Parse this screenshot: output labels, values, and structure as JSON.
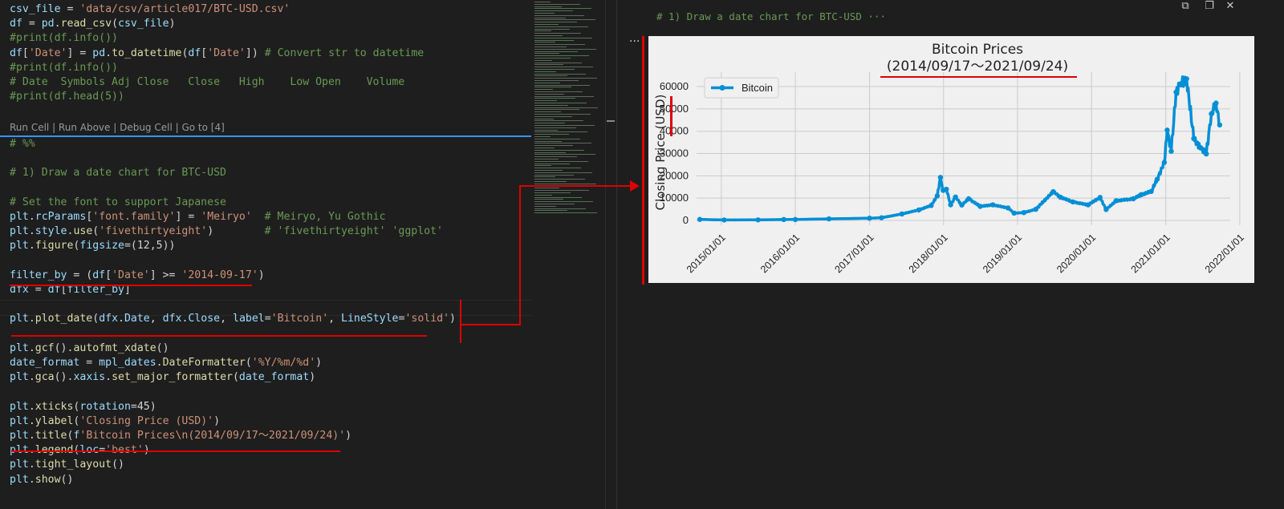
{
  "editor": {
    "lines": [
      {
        "parts": [
          {
            "c": "var",
            "t": "csv_file"
          },
          {
            "c": "plain",
            "t": " = "
          },
          {
            "c": "str",
            "t": "'data/csv/article017/BTC-USD.csv'"
          }
        ]
      },
      {
        "parts": [
          {
            "c": "var",
            "t": "df"
          },
          {
            "c": "plain",
            "t": " = "
          },
          {
            "c": "var",
            "t": "pd"
          },
          {
            "c": "plain",
            "t": "."
          },
          {
            "c": "fn",
            "t": "read_csv"
          },
          {
            "c": "plain",
            "t": "("
          },
          {
            "c": "var",
            "t": "csv_file"
          },
          {
            "c": "plain",
            "t": ")"
          }
        ]
      },
      {
        "parts": [
          {
            "c": "cmt",
            "t": "#print(df.info())"
          }
        ]
      },
      {
        "parts": [
          {
            "c": "var",
            "t": "df"
          },
          {
            "c": "plain",
            "t": "["
          },
          {
            "c": "str",
            "t": "'Date'"
          },
          {
            "c": "plain",
            "t": "] = "
          },
          {
            "c": "var",
            "t": "pd"
          },
          {
            "c": "plain",
            "t": "."
          },
          {
            "c": "fn",
            "t": "to_datetime"
          },
          {
            "c": "plain",
            "t": "("
          },
          {
            "c": "var",
            "t": "df"
          },
          {
            "c": "plain",
            "t": "["
          },
          {
            "c": "str",
            "t": "'Date'"
          },
          {
            "c": "plain",
            "t": "]) "
          },
          {
            "c": "cmt",
            "t": "# Convert str to datetime"
          }
        ]
      },
      {
        "parts": [
          {
            "c": "cmt",
            "t": "#print(df.info())"
          }
        ]
      },
      {
        "parts": [
          {
            "c": "cmt",
            "t": "# Date  Symbols Adj Close   Close   High    Low Open    Volume"
          }
        ]
      },
      {
        "parts": [
          {
            "c": "cmt",
            "t": "#print(df.head(5))"
          }
        ]
      }
    ],
    "codelens": "Run Cell | Run Above | Debug Cell | Go to [4]",
    "lines2": [
      {
        "parts": [
          {
            "c": "cmt",
            "t": "# %%"
          }
        ]
      },
      {
        "parts": []
      },
      {
        "parts": [
          {
            "c": "cmt",
            "t": "# 1) Draw a date chart for BTC-USD"
          }
        ]
      },
      {
        "parts": []
      },
      {
        "parts": [
          {
            "c": "cmt",
            "t": "# Set the font to support Japanese"
          }
        ]
      },
      {
        "parts": [
          {
            "c": "var",
            "t": "plt"
          },
          {
            "c": "plain",
            "t": "."
          },
          {
            "c": "var",
            "t": "rcParams"
          },
          {
            "c": "plain",
            "t": "["
          },
          {
            "c": "str",
            "t": "'font.family'"
          },
          {
            "c": "plain",
            "t": "] = "
          },
          {
            "c": "str",
            "t": "'Meiryo'"
          },
          {
            "c": "plain",
            "t": "  "
          },
          {
            "c": "cmt",
            "t": "# Meiryo, Yu Gothic"
          }
        ]
      },
      {
        "parts": [
          {
            "c": "var",
            "t": "plt"
          },
          {
            "c": "plain",
            "t": "."
          },
          {
            "c": "var",
            "t": "style"
          },
          {
            "c": "plain",
            "t": "."
          },
          {
            "c": "fn",
            "t": "use"
          },
          {
            "c": "plain",
            "t": "("
          },
          {
            "c": "str",
            "t": "'fivethirtyeight'"
          },
          {
            "c": "plain",
            "t": ")        "
          },
          {
            "c": "cmt",
            "t": "# 'fivethirtyeight' 'ggplot'"
          }
        ]
      },
      {
        "parts": [
          {
            "c": "var",
            "t": "plt"
          },
          {
            "c": "plain",
            "t": "."
          },
          {
            "c": "fn",
            "t": "figure"
          },
          {
            "c": "plain",
            "t": "("
          },
          {
            "c": "var",
            "t": "figsize"
          },
          {
            "c": "plain",
            "t": "=(12,5))"
          }
        ]
      },
      {
        "parts": []
      },
      {
        "parts": [
          {
            "c": "var",
            "t": "filter_by"
          },
          {
            "c": "plain",
            "t": " = ("
          },
          {
            "c": "var",
            "t": "df"
          },
          {
            "c": "plain",
            "t": "["
          },
          {
            "c": "str",
            "t": "'Date'"
          },
          {
            "c": "plain",
            "t": "] >= "
          },
          {
            "c": "str",
            "t": "'2014-09-17'"
          },
          {
            "c": "plain",
            "t": ")"
          }
        ]
      },
      {
        "parts": [
          {
            "c": "var",
            "t": "dfx"
          },
          {
            "c": "plain",
            "t": " = "
          },
          {
            "c": "var",
            "t": "df"
          },
          {
            "c": "plain",
            "t": "["
          },
          {
            "c": "var",
            "t": "filter_by"
          },
          {
            "c": "plain",
            "t": "]"
          }
        ]
      },
      {
        "parts": []
      },
      {
        "parts": [
          {
            "c": "var",
            "t": "plt"
          },
          {
            "c": "plain",
            "t": "."
          },
          {
            "c": "fn",
            "t": "plot_date"
          },
          {
            "c": "plain",
            "t": "("
          },
          {
            "c": "var",
            "t": "dfx"
          },
          {
            "c": "plain",
            "t": "."
          },
          {
            "c": "var",
            "t": "Date"
          },
          {
            "c": "plain",
            "t": ", "
          },
          {
            "c": "var",
            "t": "dfx"
          },
          {
            "c": "plain",
            "t": "."
          },
          {
            "c": "var",
            "t": "Close"
          },
          {
            "c": "plain",
            "t": ", "
          },
          {
            "c": "var",
            "t": "label"
          },
          {
            "c": "plain",
            "t": "="
          },
          {
            "c": "str",
            "t": "'Bitcoin'"
          },
          {
            "c": "plain",
            "t": ", "
          },
          {
            "c": "var",
            "t": "LineStyle"
          },
          {
            "c": "plain",
            "t": "="
          },
          {
            "c": "str",
            "t": "'solid'"
          },
          {
            "c": "plain",
            "t": ")"
          }
        ]
      },
      {
        "parts": []
      },
      {
        "parts": [
          {
            "c": "var",
            "t": "plt"
          },
          {
            "c": "plain",
            "t": "."
          },
          {
            "c": "fn",
            "t": "gcf"
          },
          {
            "c": "plain",
            "t": "()."
          },
          {
            "c": "fn",
            "t": "autofmt_xdate"
          },
          {
            "c": "plain",
            "t": "()"
          }
        ]
      },
      {
        "parts": [
          {
            "c": "var",
            "t": "date_format"
          },
          {
            "c": "plain",
            "t": " = "
          },
          {
            "c": "var",
            "t": "mpl_dates"
          },
          {
            "c": "plain",
            "t": "."
          },
          {
            "c": "fn",
            "t": "DateFormatter"
          },
          {
            "c": "plain",
            "t": "("
          },
          {
            "c": "str",
            "t": "'%Y/%m/%d'"
          },
          {
            "c": "plain",
            "t": ")"
          }
        ]
      },
      {
        "parts": [
          {
            "c": "var",
            "t": "plt"
          },
          {
            "c": "plain",
            "t": "."
          },
          {
            "c": "fn",
            "t": "gca"
          },
          {
            "c": "plain",
            "t": "()."
          },
          {
            "c": "var",
            "t": "xaxis"
          },
          {
            "c": "plain",
            "t": "."
          },
          {
            "c": "fn",
            "t": "set_major_formatter"
          },
          {
            "c": "plain",
            "t": "("
          },
          {
            "c": "var",
            "t": "date_format"
          },
          {
            "c": "plain",
            "t": ")"
          }
        ]
      },
      {
        "parts": []
      },
      {
        "parts": [
          {
            "c": "var",
            "t": "plt"
          },
          {
            "c": "plain",
            "t": "."
          },
          {
            "c": "fn",
            "t": "xticks"
          },
          {
            "c": "plain",
            "t": "("
          },
          {
            "c": "var",
            "t": "rotation"
          },
          {
            "c": "plain",
            "t": "=45)"
          }
        ]
      },
      {
        "parts": [
          {
            "c": "var",
            "t": "plt"
          },
          {
            "c": "plain",
            "t": "."
          },
          {
            "c": "fn",
            "t": "ylabel"
          },
          {
            "c": "plain",
            "t": "("
          },
          {
            "c": "str",
            "t": "'Closing Price (USD)'"
          },
          {
            "c": "plain",
            "t": ")"
          }
        ]
      },
      {
        "parts": [
          {
            "c": "var",
            "t": "plt"
          },
          {
            "c": "plain",
            "t": "."
          },
          {
            "c": "fn",
            "t": "title"
          },
          {
            "c": "plain",
            "t": "("
          },
          {
            "c": "var",
            "t": "f"
          },
          {
            "c": "str",
            "t": "'Bitcoin Prices\\n(2014/09/17～2021/09/24)'"
          },
          {
            "c": "plain",
            "t": ")"
          }
        ]
      },
      {
        "parts": [
          {
            "c": "var",
            "t": "plt"
          },
          {
            "c": "plain",
            "t": "."
          },
          {
            "c": "fn",
            "t": "legend"
          },
          {
            "c": "plain",
            "t": "("
          },
          {
            "c": "var",
            "t": "loc"
          },
          {
            "c": "plain",
            "t": "="
          },
          {
            "c": "str",
            "t": "'best'"
          },
          {
            "c": "plain",
            "t": ")"
          }
        ]
      },
      {
        "parts": [
          {
            "c": "var",
            "t": "plt"
          },
          {
            "c": "plain",
            "t": "."
          },
          {
            "c": "fn",
            "t": "tight_layout"
          },
          {
            "c": "plain",
            "t": "()"
          }
        ]
      },
      {
        "parts": [
          {
            "c": "var",
            "t": "plt"
          },
          {
            "c": "plain",
            "t": "."
          },
          {
            "c": "fn",
            "t": "show"
          },
          {
            "c": "plain",
            "t": "()"
          }
        ]
      }
    ]
  },
  "output": {
    "collapsed_cell": "# 1) Draw a date chart for BTC-USD ···",
    "ellipsis": "···",
    "toolbar": [
      "copy-icon",
      "open-icon",
      "close-icon"
    ],
    "toolbar_glyphs": [
      "⧉",
      "❐",
      "✕"
    ]
  },
  "colors": {
    "series": "#008fd5",
    "annotation": "#e00000",
    "code_var": "#9cdcfe",
    "code_str": "#ce9178",
    "code_comment": "#6a9955",
    "code_fn": "#dcdcaa"
  },
  "chart_data": {
    "type": "line",
    "title": "Bitcoin Prices",
    "subtitle": "(2014/09/17～2021/09/24)",
    "xlabel": "",
    "ylabel": "Closing Price (USD)",
    "legend_position": "top-left",
    "grid": true,
    "xlim": [
      "2014-09-17",
      "2021-09-24"
    ],
    "ylim": [
      0,
      60000
    ],
    "x_ticks": [
      "2015/01/01",
      "2016/01/01",
      "2017/01/01",
      "2018/01/01",
      "2019/01/01",
      "2020/01/01",
      "2021/01/01",
      "2022/01/01"
    ],
    "y_ticks": [
      0,
      10000,
      20000,
      30000,
      40000,
      50000,
      60000
    ],
    "series": [
      {
        "name": "Bitcoin",
        "points": [
          [
            "2014-09-17",
            457
          ],
          [
            "2015-01-15",
            210
          ],
          [
            "2015-07-01",
            260
          ],
          [
            "2015-11-05",
            400
          ],
          [
            "2016-01-01",
            430
          ],
          [
            "2016-06-15",
            700
          ],
          [
            "2017-01-01",
            1000
          ],
          [
            "2017-03-01",
            1200
          ],
          [
            "2017-06-10",
            2900
          ],
          [
            "2017-09-01",
            4700
          ],
          [
            "2017-11-01",
            6700
          ],
          [
            "2017-12-01",
            11000
          ],
          [
            "2017-12-17",
            19300
          ],
          [
            "2017-12-30",
            13500
          ],
          [
            "2018-01-15",
            14000
          ],
          [
            "2018-02-05",
            7000
          ],
          [
            "2018-03-01",
            10500
          ],
          [
            "2018-04-01",
            6900
          ],
          [
            "2018-05-05",
            9700
          ],
          [
            "2018-07-01",
            6300
          ],
          [
            "2018-09-01",
            7000
          ],
          [
            "2018-11-15",
            5600
          ],
          [
            "2018-12-15",
            3300
          ],
          [
            "2019-02-01",
            3500
          ],
          [
            "2019-04-01",
            5000
          ],
          [
            "2019-06-26",
            12900
          ],
          [
            "2019-08-01",
            10400
          ],
          [
            "2019-10-01",
            8300
          ],
          [
            "2019-12-15",
            7000
          ],
          [
            "2020-02-12",
            10300
          ],
          [
            "2020-03-13",
            4900
          ],
          [
            "2020-05-01",
            8800
          ],
          [
            "2020-07-25",
            9700
          ],
          [
            "2020-09-01",
            11500
          ],
          [
            "2020-10-21",
            13000
          ],
          [
            "2020-11-20",
            18500
          ],
          [
            "2020-12-25",
            26000
          ],
          [
            "2021-01-08",
            40500
          ],
          [
            "2021-01-28",
            31000
          ],
          [
            "2021-02-21",
            57500
          ],
          [
            "2021-03-13",
            61200
          ],
          [
            "2021-04-14",
            63500
          ],
          [
            "2021-05-19",
            36700
          ],
          [
            "2021-06-22",
            32500
          ],
          [
            "2021-07-20",
            29800
          ],
          [
            "2021-08-14",
            47800
          ],
          [
            "2021-09-06",
            52600
          ],
          [
            "2021-09-24",
            42800
          ]
        ]
      }
    ]
  }
}
